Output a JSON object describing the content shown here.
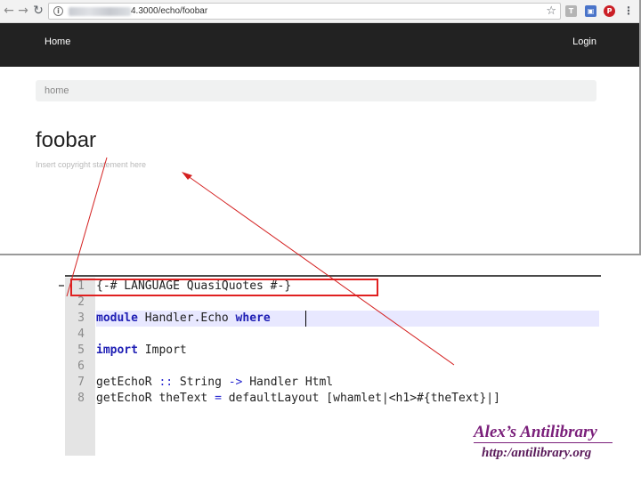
{
  "browser": {
    "address_bar": {
      "url_visible": "4.3000/echo/foobar"
    },
    "icons": {
      "back": "arrow-left-icon",
      "forward": "arrow-right-icon",
      "reload": "reload-icon",
      "info": "info-icon",
      "bookmark": "star-icon",
      "extensions": [
        "gray-extension-icon",
        "blue-extension-icon",
        "pinterest-icon"
      ],
      "menu": "kebab-menu-icon"
    }
  },
  "page": {
    "navbar": {
      "home_label": "Home",
      "login_label": "Login",
      "background": "#222222"
    },
    "breadcrumb": {
      "home_label": "home"
    },
    "title": "foobar",
    "copyright": "Insert copyright statement here"
  },
  "editor": {
    "lines": [
      {
        "num": "1",
        "tokens": [
          [
            "{-#",
            ""
          ],
          [
            " LANGUAGE ",
            ""
          ],
          [
            "QuasiQuotes",
            ""
          ],
          [
            " #-}",
            ""
          ]
        ]
      },
      {
        "num": "2",
        "tokens": []
      },
      {
        "num": "3",
        "tokens": [
          [
            "module",
            "kw"
          ],
          [
            " Handler.Echo ",
            ""
          ],
          [
            "where",
            "kw"
          ]
        ]
      },
      {
        "num": "4",
        "tokens": []
      },
      {
        "num": "5",
        "tokens": [
          [
            "import",
            "kw"
          ],
          [
            " Import",
            ""
          ]
        ]
      },
      {
        "num": "6",
        "tokens": []
      },
      {
        "num": "7",
        "tokens": [
          [
            "getEchoR ",
            ""
          ],
          [
            "::",
            "op"
          ],
          [
            " String ",
            ""
          ],
          [
            "->",
            "op"
          ],
          [
            " Handler Html",
            ""
          ]
        ]
      },
      {
        "num": "8",
        "tokens": [
          [
            "getEchoR theText ",
            ""
          ],
          [
            "=",
            "op"
          ],
          [
            " defaultLayout [whamlet|<h1>#{theText}|]",
            ""
          ]
        ]
      }
    ],
    "highlight_color": "#e02020"
  },
  "annotation": {
    "arrow_color": "#d42020"
  },
  "watermark": {
    "title": "Alex’s Antilibrary",
    "url": "http:/antilibrary.org",
    "color": "#7a1f7a"
  }
}
